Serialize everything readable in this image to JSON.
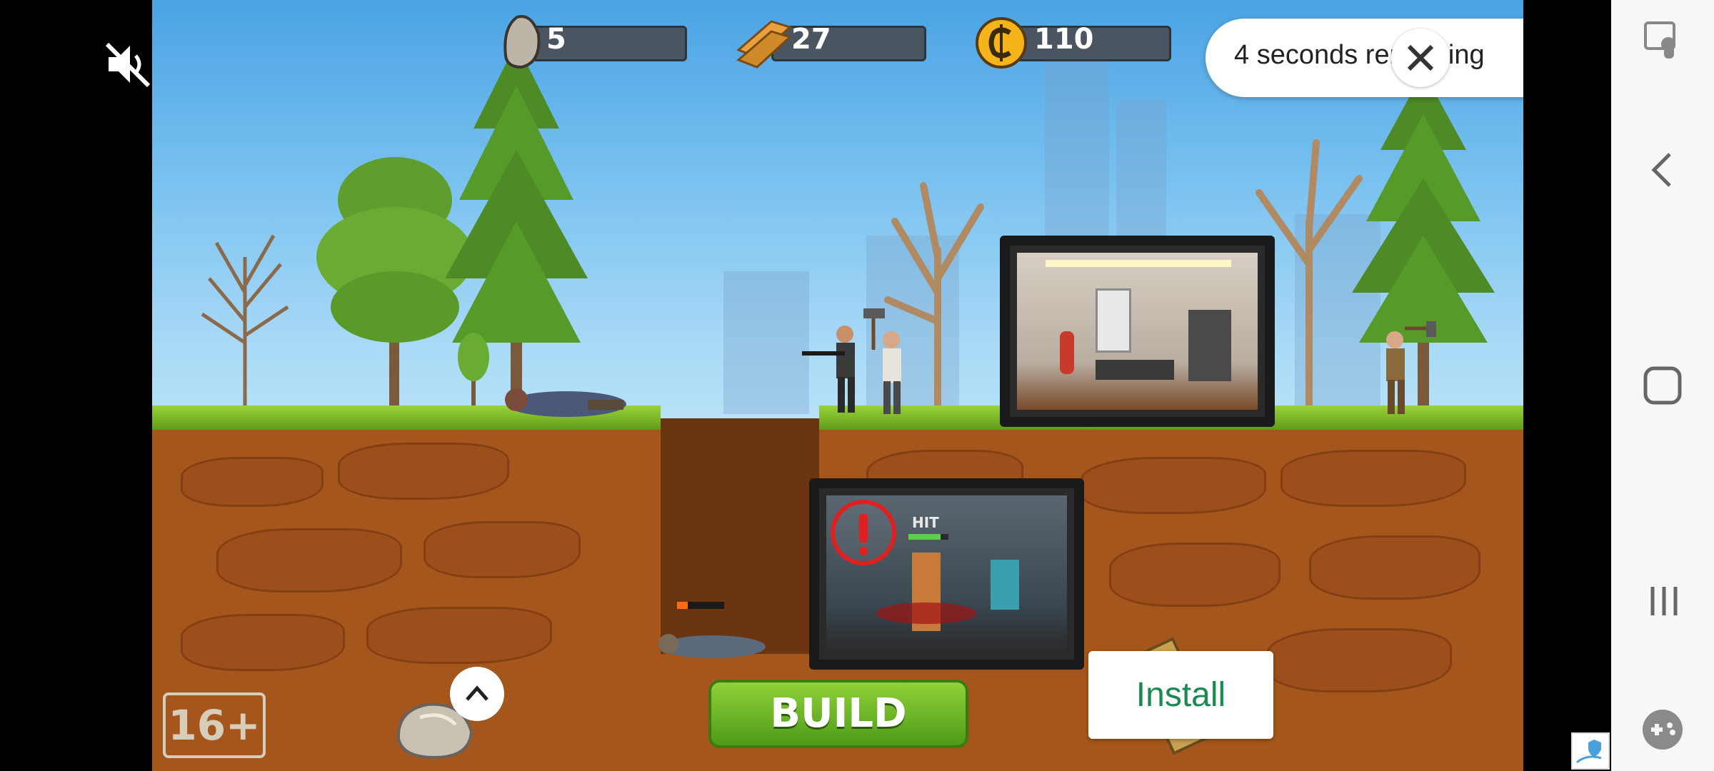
{
  "hud": {
    "stone_value": "5",
    "wood_value": "27",
    "coins_value": "110",
    "mute_icon": "speaker-muted-icon"
  },
  "ad": {
    "countdown_text": "4 seconds remaining",
    "close_icon": "close-icon",
    "install_label": "Install"
  },
  "game": {
    "build_label": "BUILD",
    "age_rating": "16+",
    "room_label": "HIT"
  },
  "nav": {
    "items": [
      "screen-touch-icon",
      "back-icon",
      "home-icon",
      "recents-icon",
      "game-tools-icon"
    ]
  },
  "colors": {
    "install_text": "#1a8a52",
    "build_green": "#6bb42a",
    "sky": "#6fb9ec",
    "dirt": "#a5561c"
  }
}
